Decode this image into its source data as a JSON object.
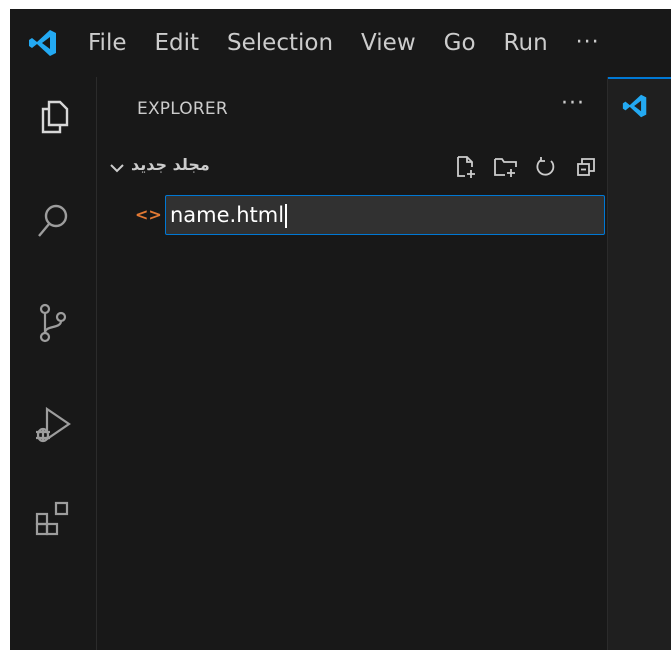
{
  "menu": {
    "items": [
      "File",
      "Edit",
      "Selection",
      "View",
      "Go",
      "Run"
    ],
    "more": "···"
  },
  "activity_bar": [
    {
      "name": "explorer-icon"
    },
    {
      "name": "search-icon"
    },
    {
      "name": "source-control-icon"
    },
    {
      "name": "run-debug-icon"
    },
    {
      "name": "extensions-icon"
    }
  ],
  "sidebar": {
    "title": "EXPLORER",
    "more": "···",
    "folder": {
      "name": "مجلد جديد",
      "actions": [
        "new-file-icon",
        "new-folder-icon",
        "refresh-icon",
        "collapse-all-icon"
      ]
    },
    "new_file": {
      "icon": "<>",
      "value": "name.html"
    }
  },
  "colors": {
    "background": "#181818",
    "accent": "#0078d4",
    "text": "#cccccc",
    "html_icon": "#e37933",
    "logo": "#23a9f2"
  }
}
